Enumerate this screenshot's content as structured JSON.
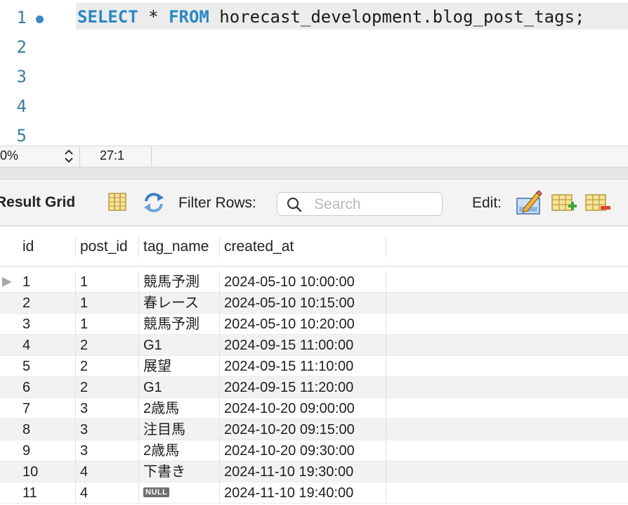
{
  "editor": {
    "lines": [
      {
        "number": "1",
        "has_marker": true,
        "keyword1": "SELECT",
        "op": " * ",
        "keyword2": "FROM",
        "rest": " horecast_development.blog_post_tags;"
      },
      {
        "number": "2"
      },
      {
        "number": "3"
      },
      {
        "number": "4"
      },
      {
        "number": "5"
      }
    ]
  },
  "status": {
    "zoom": "0%",
    "cursor_position": "27:1"
  },
  "toolbar": {
    "result_grid_label": "Result Grid",
    "filter_label": "Filter Rows:",
    "search_placeholder": "Search",
    "edit_label": "Edit:"
  },
  "grid": {
    "columns": [
      "id",
      "post_id",
      "tag_name",
      "created_at"
    ],
    "rows": [
      {
        "id": "1",
        "post_id": "1",
        "tag_name": "競馬予測",
        "created_at": "2024-05-10 10:00:00",
        "current": true
      },
      {
        "id": "2",
        "post_id": "1",
        "tag_name": "春レース",
        "created_at": "2024-05-10 10:15:00"
      },
      {
        "id": "3",
        "post_id": "1",
        "tag_name": "競馬予測",
        "created_at": "2024-05-10 10:20:00"
      },
      {
        "id": "4",
        "post_id": "2",
        "tag_name": "G1",
        "created_at": "2024-09-15 11:00:00"
      },
      {
        "id": "5",
        "post_id": "2",
        "tag_name": "展望",
        "created_at": "2024-09-15 11:10:00"
      },
      {
        "id": "6",
        "post_id": "2",
        "tag_name": "G1",
        "created_at": "2024-09-15 11:20:00"
      },
      {
        "id": "7",
        "post_id": "3",
        "tag_name": "2歳馬",
        "created_at": "2024-10-20 09:00:00"
      },
      {
        "id": "8",
        "post_id": "3",
        "tag_name": "注目馬",
        "created_at": "2024-10-20 09:15:00"
      },
      {
        "id": "9",
        "post_id": "3",
        "tag_name": "2歳馬",
        "created_at": "2024-10-20 09:30:00"
      },
      {
        "id": "10",
        "post_id": "4",
        "tag_name": "下書き",
        "created_at": "2024-11-10 19:30:00"
      },
      {
        "id": "11",
        "post_id": "4",
        "tag_name": "NULL",
        "is_null": true,
        "created_at": "2024-11-10 19:40:00"
      }
    ]
  },
  "icons": {
    "form_editor": "form-editor-icon",
    "refresh": "refresh-icon",
    "search": "search-icon",
    "edit_cell": "edit-cell-icon",
    "add_row": "add-row-icon",
    "delete_row": "delete-row-icon",
    "zoom_stepper": "up-down-chevron-icon",
    "row_indicator": "row-pointer-icon"
  },
  "colors": {
    "keyword": "#2b87c2",
    "line_number": "#3a7d9c",
    "marker": "#3b88c9",
    "current_line_bg": "#ececec"
  }
}
